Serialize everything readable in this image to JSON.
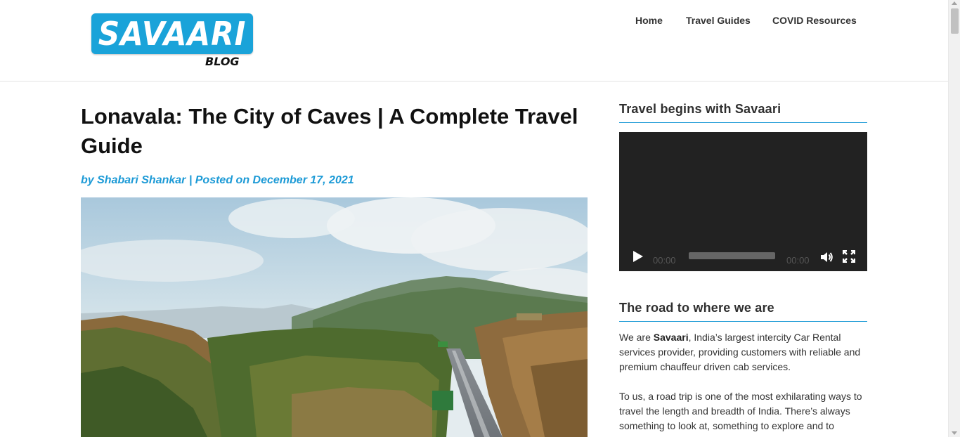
{
  "logo": {
    "text": "SAVAARI",
    "subtext": "BLOG"
  },
  "nav": {
    "items": [
      "Home",
      "Travel Guides",
      "COVID Resources"
    ]
  },
  "article": {
    "title": "Lonavala: The City of Caves | A Complete Travel Guide",
    "byline": "by Shabari Shankar | Posted on December 17, 2021"
  },
  "sidebar": {
    "video_heading": "Travel begins with Savaari",
    "video": {
      "current_time": "00:00",
      "duration": "00:00",
      "progress": 0
    },
    "about_heading": "The road to where we are",
    "para1_prefix": "We are ",
    "para1_brand": "Savaari",
    "para1_rest": ", India’s largest intercity Car Rental services provider, providing customers with reliable and premium chauffeur driven cab services.",
    "para2": "To us, a road trip is one of the most exhilarating ways to travel the length and breadth of India. There’s always something to look at, something to explore and to"
  },
  "colors": {
    "accent": "#1c9ad6",
    "logo_bg": "#1aa3d9",
    "video_bg": "#222222"
  }
}
